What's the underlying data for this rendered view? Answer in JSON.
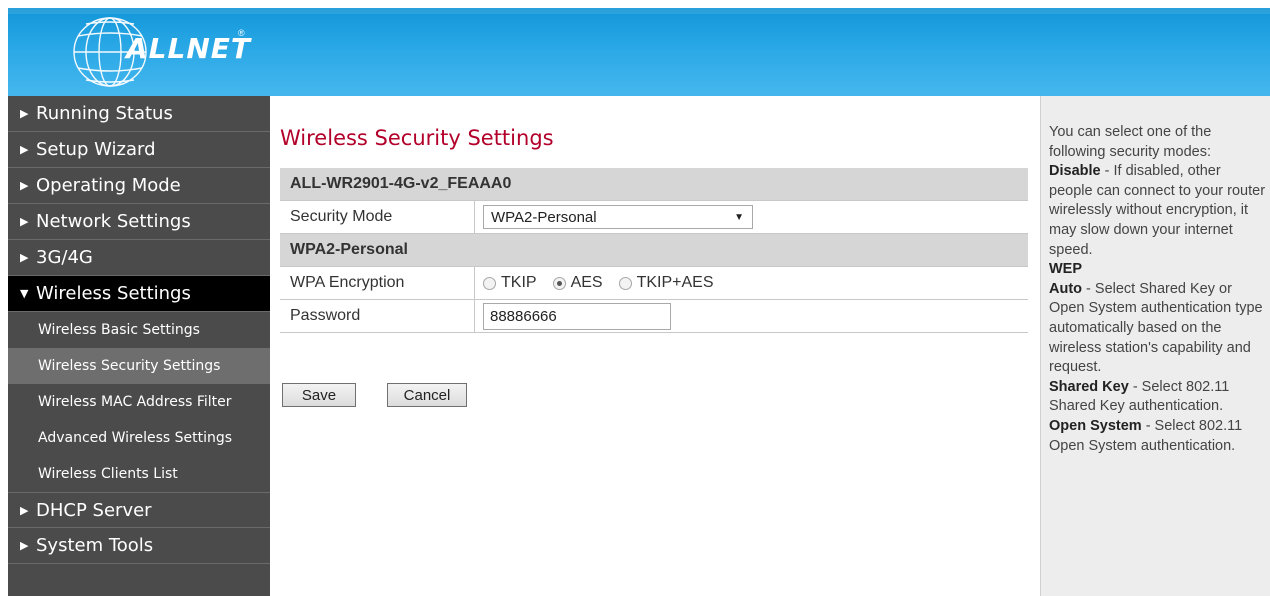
{
  "header": {
    "brand": "ALLNET",
    "reg": "®"
  },
  "sidebar": {
    "items": [
      {
        "label": "Running Status",
        "arrow": "▶"
      },
      {
        "label": "Setup Wizard",
        "arrow": "▶"
      },
      {
        "label": "Operating Mode",
        "arrow": "▶"
      },
      {
        "label": "Network Settings",
        "arrow": "▶"
      },
      {
        "label": "3G/4G",
        "arrow": "▶"
      },
      {
        "label": "Wireless Settings",
        "arrow": "▼"
      }
    ],
    "subitems": [
      "Wireless Basic Settings",
      "Wireless Security Settings",
      "Wireless MAC Address Filter",
      "Advanced Wireless Settings",
      "Wireless Clients List"
    ],
    "items_after": [
      {
        "label": "DHCP Server",
        "arrow": "▶"
      },
      {
        "label": "System Tools",
        "arrow": "▶"
      }
    ]
  },
  "main": {
    "title": "Wireless Security Settings",
    "ssid": "ALL-WR2901-4G-v2_FEAAA0",
    "security_mode_label": "Security Mode",
    "security_mode_value": "WPA2-Personal",
    "section_label": "WPA2-Personal",
    "wpa_encryption_label": "WPA Encryption",
    "encryption_options": [
      "TKIP",
      "AES",
      "TKIP+AES"
    ],
    "encryption_selected": "AES",
    "password_label": "Password",
    "password_value": "88886666",
    "save_label": "Save",
    "cancel_label": "Cancel"
  },
  "help": {
    "intro": "You can select one of the following security modes:",
    "disable_title": "Disable",
    "disable_text": " - If disabled, other people can connect to your router wirelessly without encryption, it may slow down your internet speed.",
    "wep_title": "WEP",
    "auto_title": "Auto",
    "auto_text": " - Select Shared Key or Open System authentication type automatically based on the wireless station's capability and request.",
    "shared_title": "Shared Key",
    "shared_text": " - Select 802.11 Shared Key authentication.",
    "open_title": "Open System",
    "open_text": " - Select 802.11 Open System authentication."
  },
  "colors": {
    "title": "#b3002a",
    "header": "#2aa8e6",
    "sidebar": "#4b4b4b"
  }
}
